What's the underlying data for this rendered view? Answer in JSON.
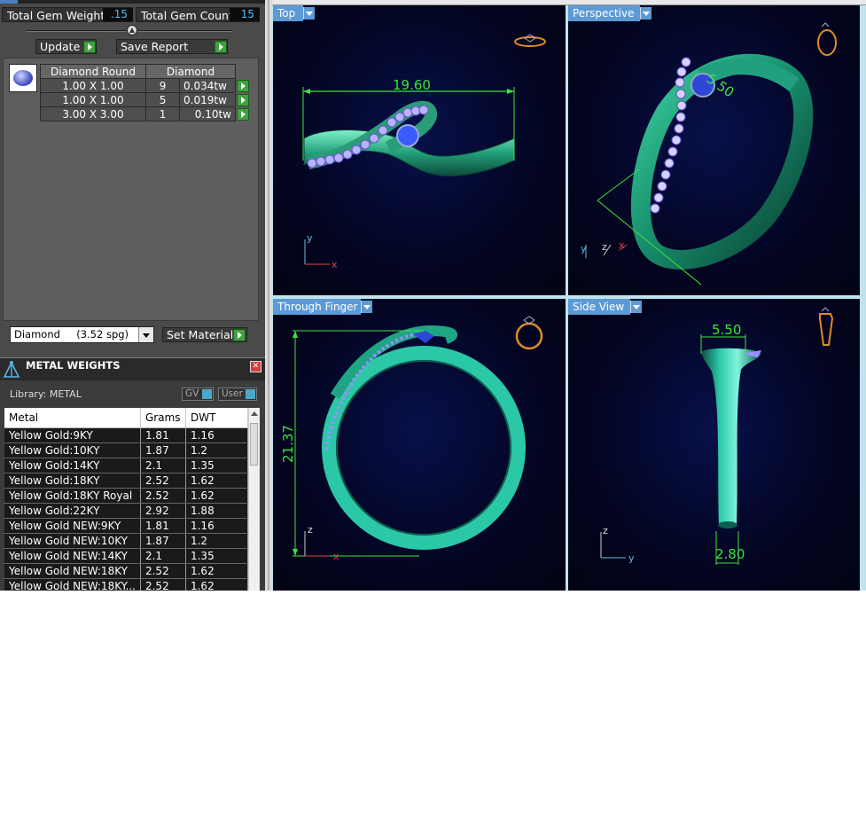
{
  "gem_summary": {
    "weight_label": "Total Gem Weight",
    "weight_value": ".15",
    "count_label": "Total Gem Count",
    "count_value": "15"
  },
  "actions": {
    "update_label": "Update",
    "save_report_label": "Save Report"
  },
  "gem_table": {
    "headers": [
      "Diamond Round",
      "Diamond"
    ],
    "rows": [
      {
        "size": "1.00 X 1.00",
        "count": "9",
        "weight": "0.034tw"
      },
      {
        "size": "1.00 X 1.00",
        "count": "5",
        "weight": "0.019tw"
      },
      {
        "size": "3.00 X 3.00",
        "count": "1",
        "weight": "0.10tw"
      }
    ]
  },
  "material": {
    "selected": "Diamond     (3.52 spg)",
    "set_label": "Set Material"
  },
  "metal_weights": {
    "title": "METAL WEIGHTS",
    "library_label": "Library: METAL",
    "gv_label": "GV",
    "user_label": "User",
    "columns": [
      "Metal",
      "Grams",
      "DWT"
    ],
    "rows": [
      {
        "metal": "Yellow Gold:9KY",
        "grams": "1.81",
        "dwt": "1.16"
      },
      {
        "metal": "Yellow Gold:10KY",
        "grams": "1.87",
        "dwt": "1.2"
      },
      {
        "metal": "Yellow Gold:14KY",
        "grams": "2.1",
        "dwt": "1.35"
      },
      {
        "metal": "Yellow Gold:18KY",
        "grams": "2.52",
        "dwt": "1.62"
      },
      {
        "metal": "Yellow Gold:18KY Royal",
        "grams": "2.52",
        "dwt": "1.62"
      },
      {
        "metal": "Yellow Gold:22KY",
        "grams": "2.92",
        "dwt": "1.88"
      },
      {
        "metal": "Yellow Gold NEW:9KY",
        "grams": "1.81",
        "dwt": "1.16"
      },
      {
        "metal": "Yellow Gold NEW:10KY",
        "grams": "1.87",
        "dwt": "1.2"
      },
      {
        "metal": "Yellow Gold NEW:14KY",
        "grams": "2.1",
        "dwt": "1.35"
      },
      {
        "metal": "Yellow Gold NEW:18KY",
        "grams": "2.52",
        "dwt": "1.62"
      },
      {
        "metal": "Yellow Gold NEW:18KY...",
        "grams": "2.52",
        "dwt": "1.62"
      }
    ]
  },
  "viewports": {
    "top": {
      "label": "Top",
      "dimension": "19.60"
    },
    "perspective": {
      "label": "Perspective",
      "dimension_top": "5.50"
    },
    "through_finger": {
      "label": "Through Finger",
      "dimension": "21.37"
    },
    "side_view": {
      "label": "Side View",
      "dimension_top": "5.50",
      "dimension_bottom": "2.80"
    },
    "axis": {
      "x": "x",
      "y": "y",
      "z": "z"
    }
  },
  "colors": {
    "metal_green": "#2fb58a",
    "gem_blue": "#2f47d8",
    "dimension_green": "#39e639",
    "tab_blue": "#5c9ad6"
  }
}
